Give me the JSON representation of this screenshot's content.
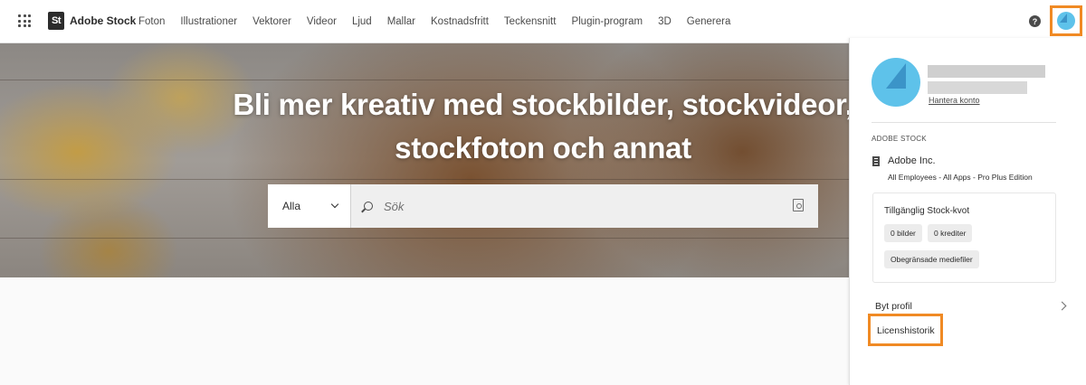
{
  "header": {
    "brand_mark": "St",
    "brand_name": "Adobe Stock",
    "nav": [
      "Foton",
      "Illustrationer",
      "Vektorer",
      "Videor",
      "Ljud",
      "Mallar",
      "Kostnadsfritt",
      "Teckensnitt",
      "Plugin-program",
      "3D",
      "Generera"
    ],
    "help_glyph": "?"
  },
  "hero": {
    "title_line1": "Bli mer kreativ med stockbilder, stockvideor,",
    "title_line2": "stockfoton och annat",
    "search": {
      "category": "Alla",
      "placeholder": "Sök"
    }
  },
  "account_panel": {
    "manage_link": "Hantera konto",
    "section_label": "ADOBE STOCK",
    "org_name": "Adobe Inc.",
    "org_plan": "All Employees - All Apps - Pro Plus Edition",
    "quota": {
      "title": "Tillgänglig Stock-kvot",
      "images": "0 bilder",
      "credits": "0 krediter",
      "unlimited": "Obegränsade mediefiler"
    },
    "switch_profile": "Byt profil",
    "license_history": "Licenshistorik"
  },
  "colors": {
    "highlight": "#f08a24",
    "avatar": "#5ec2ea",
    "avatar_shade": "#3b94c8"
  },
  "icons": {
    "apps": "apps-grid-icon",
    "help": "help-icon",
    "search": "search-icon",
    "visual_search": "visual-search-icon",
    "org": "building-icon",
    "chevron_right": "chevron-right-icon",
    "chevron_down": "chevron-down-icon"
  }
}
